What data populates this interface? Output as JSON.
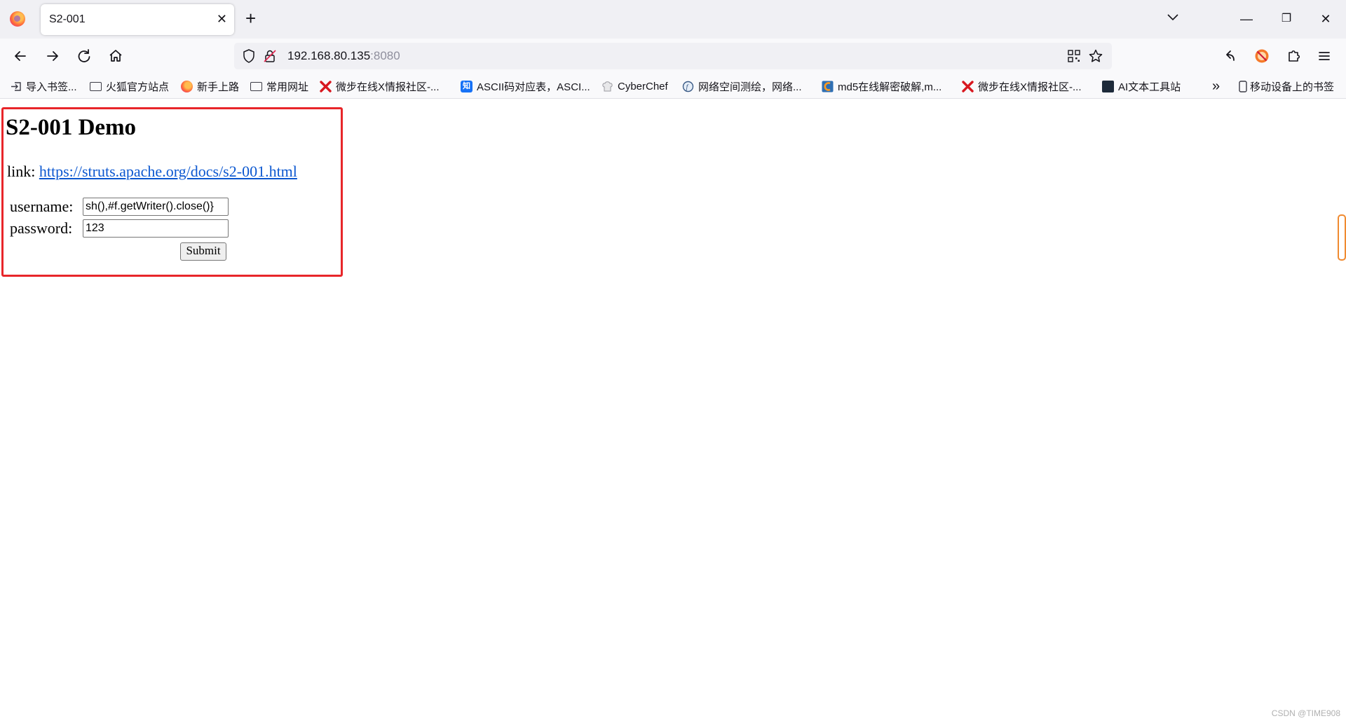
{
  "tab": {
    "title": "S2-001"
  },
  "window": {
    "new_tab": "+",
    "close_tab": "✕",
    "minimize": "—",
    "restore": "❐",
    "close": "✕"
  },
  "urlbar": {
    "host": "192.168.80.135",
    "port": ":8080"
  },
  "bookmarks": {
    "items": [
      {
        "label": "导入书签...",
        "icon": "import-icon"
      },
      {
        "label": "火狐官方站点",
        "icon": "folder-icon"
      },
      {
        "label": "新手上路",
        "icon": "firefox-icon"
      },
      {
        "label": "常用网址",
        "icon": "folder-icon"
      },
      {
        "label": "微步在线X情报社区-...",
        "icon": "threatbook-icon"
      },
      {
        "label": "ASCII码对应表，ASCI...",
        "icon": "zhihu-icon"
      },
      {
        "label": "CyberChef",
        "icon": "cyberchef-icon"
      },
      {
        "label": "网络空间测绘，网络...",
        "icon": "fofa-icon"
      },
      {
        "label": "md5在线解密破解,m...",
        "icon": "md5-icon"
      },
      {
        "label": "微步在线X情报社区-...",
        "icon": "threatbook-icon"
      },
      {
        "label": "AI文本工具站",
        "icon": "ai-tool-icon"
      }
    ],
    "overflow": "»",
    "mobile": "移动设备上的书签"
  },
  "page": {
    "heading": "S2-001 Demo",
    "link_prefix": "link: ",
    "link_text": "https://struts.apache.org/docs/s2-001.html",
    "username_label": "username:",
    "username_value": "sh(),#f.getWriter().close()}",
    "password_label": "password:",
    "password_value": "123",
    "submit_label": "Submit"
  },
  "watermark": "CSDN @TIME908",
  "colors": {
    "highlight_box": "#e8262a",
    "link": "#0b57d0",
    "threatbook": "#d8171f",
    "zhihu": "#1772f6"
  }
}
